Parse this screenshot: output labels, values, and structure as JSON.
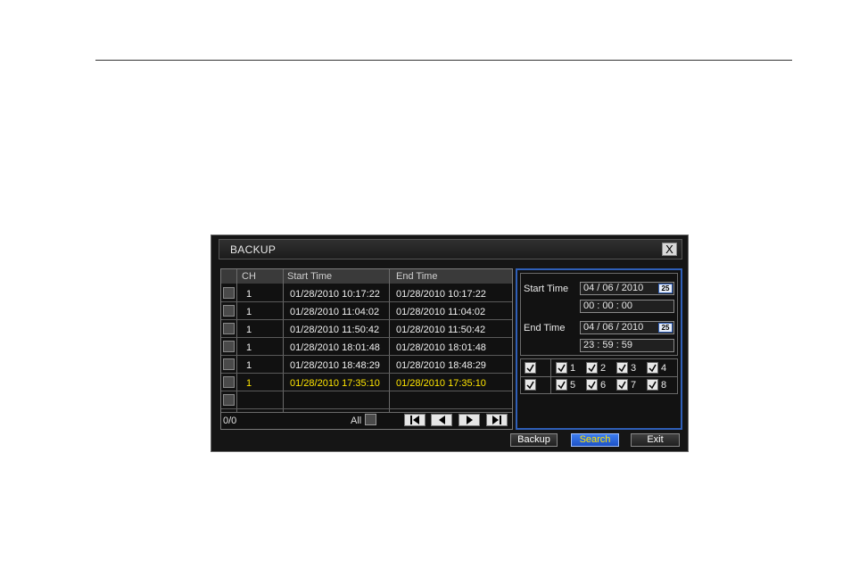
{
  "window": {
    "title": "BACKUP",
    "close_label": "X"
  },
  "table": {
    "headers": [
      "CH",
      "Start Time",
      "End Time"
    ],
    "rows": [
      {
        "ch": "1",
        "start": "01/28/2010  10:17:22",
        "end": "01/28/2010  10:17:22",
        "highlighted": false
      },
      {
        "ch": "1",
        "start": "01/28/2010  11:04:02",
        "end": "01/28/2010  11:04:02",
        "highlighted": false
      },
      {
        "ch": "1",
        "start": "01/28/2010  11:50:42",
        "end": "01/28/2010  11:50:42",
        "highlighted": false
      },
      {
        "ch": "1",
        "start": "01/28/2010  18:01:48",
        "end": "01/28/2010  18:01:48",
        "highlighted": false
      },
      {
        "ch": "1",
        "start": "01/28/2010  18:48:29",
        "end": "01/28/2010  18:48:29",
        "highlighted": false
      },
      {
        "ch": "1",
        "start": "01/28/2010  17:35:10",
        "end": "01/28/2010  17:35:10",
        "highlighted": true
      },
      {
        "ch": "",
        "start": "",
        "end": "",
        "highlighted": false
      }
    ],
    "count": "0/0",
    "all_label": "All",
    "nav_icons": [
      "first-page-icon",
      "prev-page-icon",
      "next-page-icon",
      "last-page-icon"
    ]
  },
  "search": {
    "start_label": "Start  Time",
    "start_date": "04 / 06 / 2010",
    "start_time": "00  :  00  :  00",
    "end_label": "End  Time",
    "end_date": "04 / 06 / 2010",
    "end_time": "23  :  59  :  59",
    "calendar_label": "25",
    "channels_row1": [
      "1",
      "2",
      "3",
      "4"
    ],
    "channels_row2": [
      "5",
      "6",
      "7",
      "8"
    ]
  },
  "buttons": {
    "backup": "Backup",
    "search": "Search",
    "exit": "Exit"
  },
  "colors": {
    "highlight_text": "#ffe500",
    "accent_blue": "#2f5fb8",
    "primary_button": "#2b63db"
  }
}
